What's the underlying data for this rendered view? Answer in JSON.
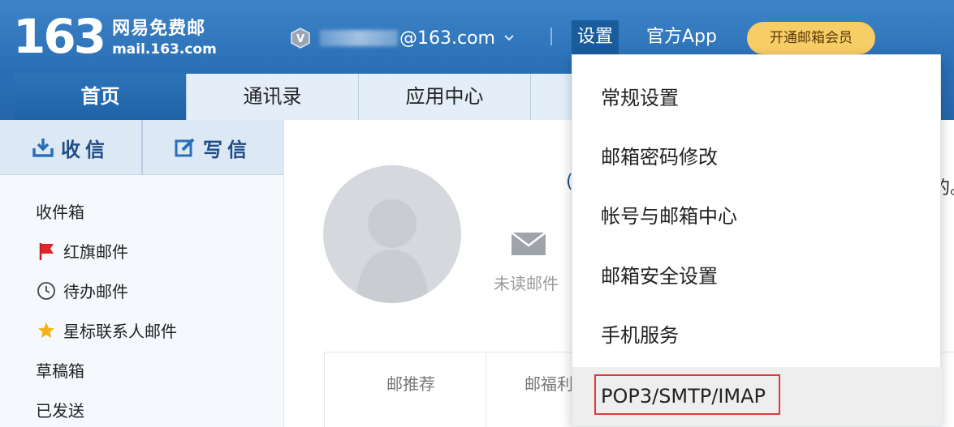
{
  "brand": {
    "number": "163",
    "name_cn": "网易免费邮",
    "domain": "mail.163.com"
  },
  "account": {
    "email_domain": "@163.com"
  },
  "header_links": {
    "settings": "设置",
    "app": "官方App",
    "member": "开通邮箱会员"
  },
  "tabs": [
    {
      "label": "首页"
    },
    {
      "label": "通讯录"
    },
    {
      "label": "应用中心"
    },
    {
      "label": ""
    }
  ],
  "compose": {
    "receive": "收信",
    "write": "写信"
  },
  "folders": [
    {
      "label": "收件箱",
      "icon": "none"
    },
    {
      "label": "红旗邮件",
      "icon": "red-flag-icon"
    },
    {
      "label": "待办邮件",
      "icon": "clock-icon"
    },
    {
      "label": "星标联系人邮件",
      "icon": "star-icon"
    },
    {
      "label": "草稿箱",
      "icon": "none"
    },
    {
      "label": "已发送",
      "icon": "none"
    }
  ],
  "main": {
    "unread_label": "未读邮件",
    "fragment_left": "(",
    "fragment_right": "的。",
    "section_tabs": [
      "邮推荐",
      "邮福利"
    ]
  },
  "settings_menu": [
    {
      "label": "常规设置"
    },
    {
      "label": "邮箱密码修改"
    },
    {
      "label": "帐号与邮箱中心"
    },
    {
      "label": "邮箱安全设置"
    },
    {
      "label": "手机服务"
    },
    {
      "label": "POP3/SMTP/IMAP"
    }
  ],
  "colors": {
    "header_blue": "#2a6fb6",
    "member_gold": "#f7cd66",
    "highlight_red": "#e03a3a"
  }
}
